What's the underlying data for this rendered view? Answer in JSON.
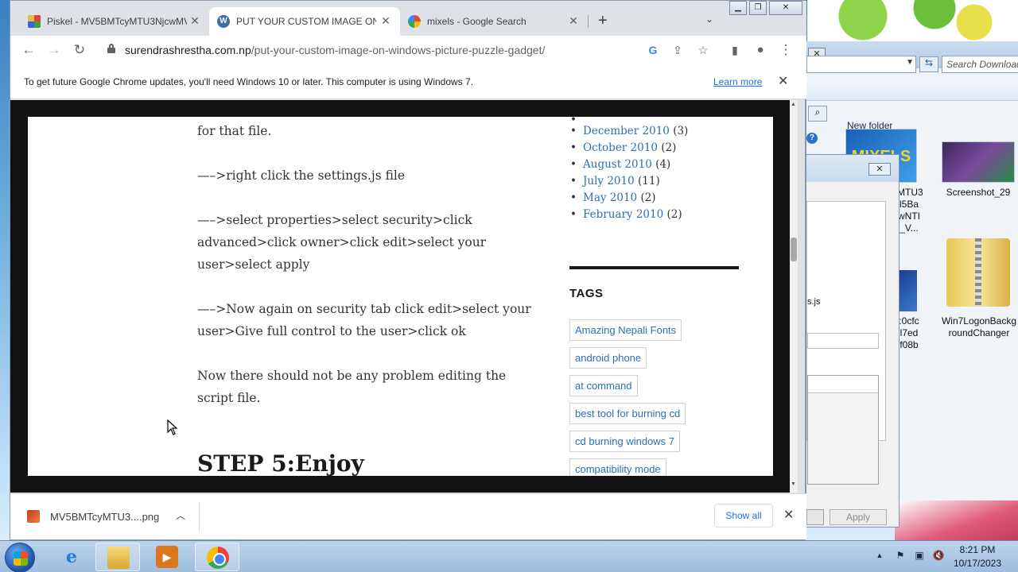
{
  "chrome": {
    "tabs": [
      {
        "title": "Piskel - MV5BMTcyMTU3NjcwMV",
        "icon": "piskel-icon"
      },
      {
        "title": "PUT YOUR CUSTOM IMAGE ON W",
        "icon": "wordpress-icon"
      },
      {
        "title": "mixels - Google Search",
        "icon": "google-icon"
      }
    ],
    "tab_close": "✕",
    "new_tab": "+",
    "tab_dropdown": "⌄",
    "url_host": "surendrashrestha.com.np",
    "url_path": "/put-your-custom-image-on-windows-picture-puzzle-gadget/",
    "infobar_text": "To get future Google Chrome updates, you'll need Windows 10 or later. This computer is using Windows 7.",
    "learn_more": "Learn more",
    "close_glyph": "✕"
  },
  "article": {
    "p1": "for that file.",
    "p2": "—–>right click the settings.js file",
    "p3": "—–>select properties>select security>click advanced>click owner>click edit>select your user>select apply",
    "p4": "—–>Now again on security tab click edit>select your user>Give full control to the user>click ok",
    "p5": "Now there should not be any problem editing the script file.",
    "step5": "STEP 5:Enjoy"
  },
  "sidebar": {
    "archives": [
      {
        "month": "December 2010",
        "count": "(3)"
      },
      {
        "month": "October 2010",
        "count": "(2)"
      },
      {
        "month": "August 2010",
        "count": "(4)"
      },
      {
        "month": "July 2010",
        "count": "(11)"
      },
      {
        "month": "May 2010",
        "count": "(2)"
      },
      {
        "month": "February 2010",
        "count": "(2)"
      }
    ],
    "tags_heading": "TAGS",
    "tags": [
      "Amazing Nepali Fonts",
      "android phone",
      "at command",
      "best tool for burning cd",
      "cd burning windows 7",
      "compatibility mode"
    ]
  },
  "downloads": {
    "file_name": "MV5BMTcyMTU3....png",
    "show_all": "Show all"
  },
  "explorer": {
    "search_placeholder": "Search Download",
    "new_folder": "New folder",
    "files": [
      {
        "label": "MTU3\nl5Ba\nwNTI\n_V..."
      },
      {
        "label": "Screenshot_29"
      },
      {
        "label": ":0cfc\nl7ed\nf08b"
      },
      {
        "label": "Win7LogonBackg\nroundChanger"
      }
    ],
    "mixels_text": "MIXELS"
  },
  "dialog": {
    "file_label": "s.js",
    "apply": "Apply"
  },
  "taskbar": {
    "time": "8:21 PM",
    "date": "10/17/2023"
  }
}
